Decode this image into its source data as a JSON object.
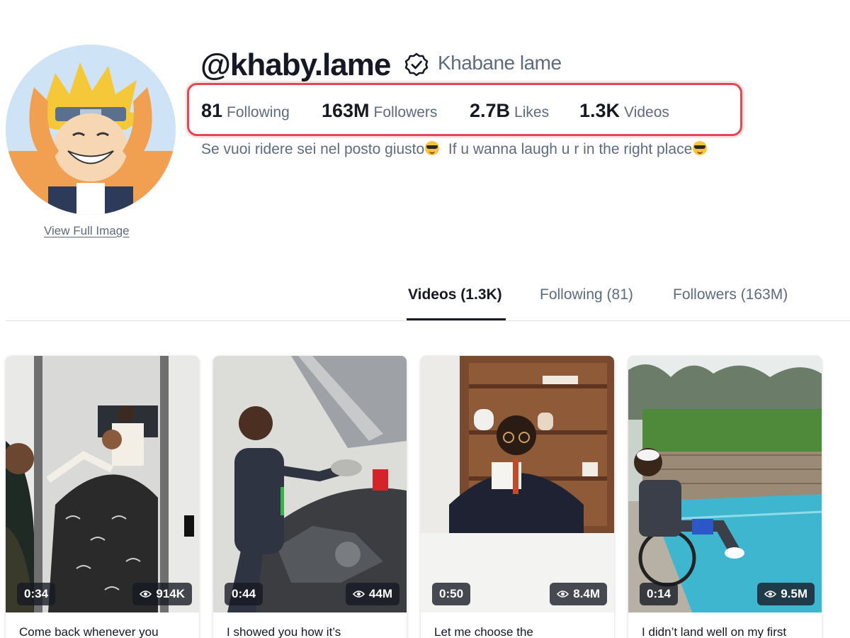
{
  "profile": {
    "view_full_image": "View Full Image",
    "username": "@khaby.lame",
    "display_name": "Khabane lame",
    "verified": true,
    "bio_part1": "Se vuoi ridere sei nel posto giusto",
    "bio_part2": "If u wanna laugh u r in the right place",
    "bio_emoji": "smiling-face-with-sunglasses"
  },
  "stats": [
    {
      "value": "81",
      "label": "Following"
    },
    {
      "value": "163M",
      "label": "Followers"
    },
    {
      "value": "2.7B",
      "label": "Likes"
    },
    {
      "value": "1.3K",
      "label": "Videos"
    }
  ],
  "tabs": [
    {
      "label": "Videos (1.3K)",
      "active": true
    },
    {
      "label": "Following (81)",
      "active": false
    },
    {
      "label": "Followers (163M)",
      "active": false
    }
  ],
  "videos": [
    {
      "duration": "0:34",
      "views": "914K",
      "caption": "Come back whenever you"
    },
    {
      "duration": "0:44",
      "views": "44M",
      "caption": "I showed you how it’s"
    },
    {
      "duration": "0:50",
      "views": "8.4M",
      "caption": "Let me choose the"
    },
    {
      "duration": "0:14",
      "views": "9.5M",
      "caption": "I didn’t land well on my first"
    }
  ],
  "colors": {
    "highlight_border": "#e4474f",
    "text_primary": "#161823",
    "text_secondary": "#5d6b80"
  }
}
